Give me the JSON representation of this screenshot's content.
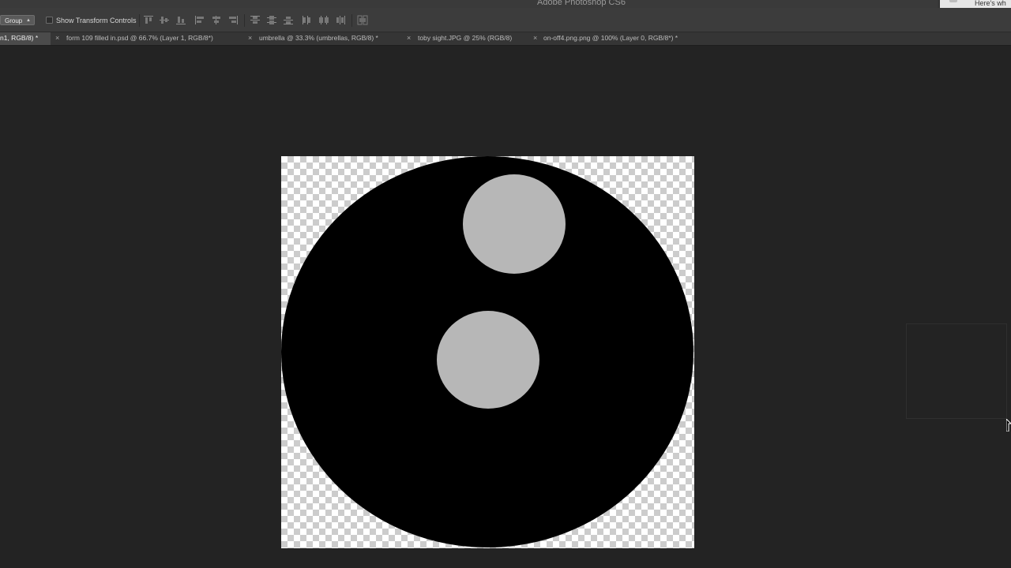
{
  "app": {
    "window_title": "Adobe Photoshop CS6",
    "notification_text": "Here's wh"
  },
  "options_bar": {
    "auto_select_value": "Group",
    "show_transform_controls_label": "Show Transform Controls",
    "show_transform_controls_checked": false,
    "align_icons": [
      "align-top-edges-icon",
      "align-vertical-centers-icon",
      "align-bottom-edges-icon",
      "align-left-edges-icon",
      "align-horizontal-centers-icon",
      "align-right-edges-icon"
    ],
    "distribute_icons": [
      "distribute-top-edges-icon",
      "distribute-vertical-centers-icon",
      "distribute-bottom-edges-icon",
      "distribute-left-edges-icon",
      "distribute-horizontal-centers-icon",
      "distribute-right-edges-icon"
    ],
    "auto_align_icon": "auto-align-layers-icon"
  },
  "tabs": [
    {
      "label": "n1, RGB/8) *",
      "active": true
    },
    {
      "label": "form 109 filled in.psd @ 66.7% (Layer 1, RGB/8*)",
      "active": false
    },
    {
      "label": "umbrella @ 33.3% (umbrellas, RGB/8) *",
      "active": false
    },
    {
      "label": "toby sight.JPG @ 25% (RGB/8)",
      "active": false
    },
    {
      "label": "on-off4.png.png @ 100% (Layer 0, RGB/8*) *",
      "active": false
    }
  ],
  "tab_close_glyph": "×",
  "document": {
    "colors": {
      "big_circle": "#000000",
      "small_circles": "#b7b7b7",
      "transparency_light": "#ffffff",
      "transparency_dark": "#cccccc"
    }
  }
}
